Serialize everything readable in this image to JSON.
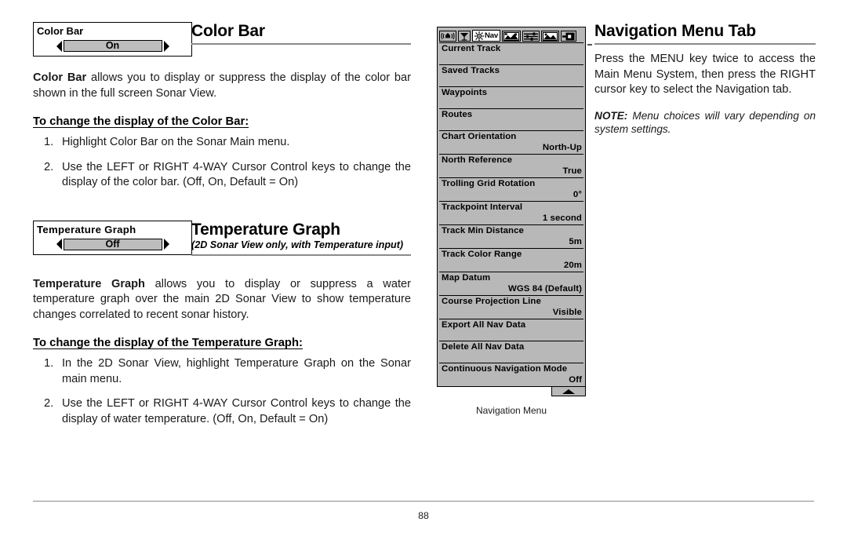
{
  "page": {
    "number": "88"
  },
  "sections": [
    {
      "id": "color-bar",
      "widget": {
        "title": "Color Bar",
        "value": "On",
        "left_arrow": "left-arrow-icon",
        "right_arrow": "right-arrow-icon"
      },
      "heading": "Color Bar",
      "subhead": "",
      "paragraph_lead": "Color Bar",
      "paragraph_rest": " allows you to display or suppress the display of the color bar shown in the full screen Sonar View.",
      "procedure_heading": "To change the display of the Color Bar:",
      "steps": [
        {
          "num": "1.",
          "text": "Highlight Color Bar on the Sonar Main menu."
        },
        {
          "num": "2.",
          "text": "Use the LEFT or RIGHT 4-WAY Cursor Control keys to change the display of the color bar. (Off, On, Default = On)"
        }
      ]
    },
    {
      "id": "temperature-graph",
      "widget": {
        "title": "Temperature Graph",
        "value": "Off",
        "left_arrow": "left-arrow-icon",
        "right_arrow": "right-arrow-icon"
      },
      "heading": "Temperature Graph",
      "subhead": "(2D Sonar View only, with Temperature input)",
      "paragraph_lead": "Temperature Graph",
      "paragraph_rest": " allows you to display or suppress a water temperature graph over the main 2D Sonar View to show temperature changes correlated to recent sonar history.",
      "procedure_heading": "To change the display of the Temperature Graph:",
      "steps": [
        {
          "num": "1.",
          "text": "In the 2D Sonar View, highlight Temperature Graph on the Sonar main menu."
        },
        {
          "num": "2.",
          "text": "Use the LEFT or RIGHT 4-WAY Cursor Control keys to change the display of water temperature. (Off, On, Default = On)"
        }
      ]
    }
  ],
  "device": {
    "caption": "Navigation Menu",
    "background_color": "#b8b8b8",
    "tabs": [
      {
        "icon": "alarm-speaker-icon",
        "label": "",
        "active": false
      },
      {
        "icon": "sonar-fish-icon",
        "label": "",
        "active": false
      },
      {
        "icon": "nav-compass-icon",
        "label": "Nav",
        "active": true
      },
      {
        "icon": "chart-icon",
        "label": "",
        "active": false
      },
      {
        "icon": "setup-sliders-icon",
        "label": "",
        "active": false
      },
      {
        "icon": "views-image-icon",
        "label": "",
        "active": false
      },
      {
        "icon": "accessories-icon",
        "label": "",
        "active": false
      }
    ],
    "menu_items": [
      {
        "label": "Current Track",
        "value": ""
      },
      {
        "label": "Saved Tracks",
        "value": ""
      },
      {
        "label": "Waypoints",
        "value": ""
      },
      {
        "label": "Routes",
        "value": ""
      },
      {
        "label": "Chart Orientation",
        "value": "North-Up"
      },
      {
        "label": "North Reference",
        "value": "True"
      },
      {
        "label": "Trolling Grid Rotation",
        "value": "0°"
      },
      {
        "label": "Trackpoint Interval",
        "value": "1 second"
      },
      {
        "label": "Track Min Distance",
        "value": "5m"
      },
      {
        "label": "Track Color Range",
        "value": "20m"
      },
      {
        "label": "Map Datum",
        "value": "WGS 84 (Default)"
      },
      {
        "label": "Course Projection Line",
        "value": "Visible"
      },
      {
        "label": "Export All Nav Data",
        "value": ""
      },
      {
        "label": "Delete All Nav Data",
        "value": ""
      },
      {
        "label": "Continuous Navigation Mode",
        "value": "Off"
      }
    ],
    "scroll_button": "scroll-up-icon"
  },
  "right_column": {
    "heading": "Navigation Menu Tab",
    "paragraph": "Press the MENU key twice to access the Main Menu System, then press the RIGHT cursor key to select the Navigation tab.",
    "note_label": "NOTE:",
    "note_text": " Menu choices will vary depending on system settings."
  }
}
